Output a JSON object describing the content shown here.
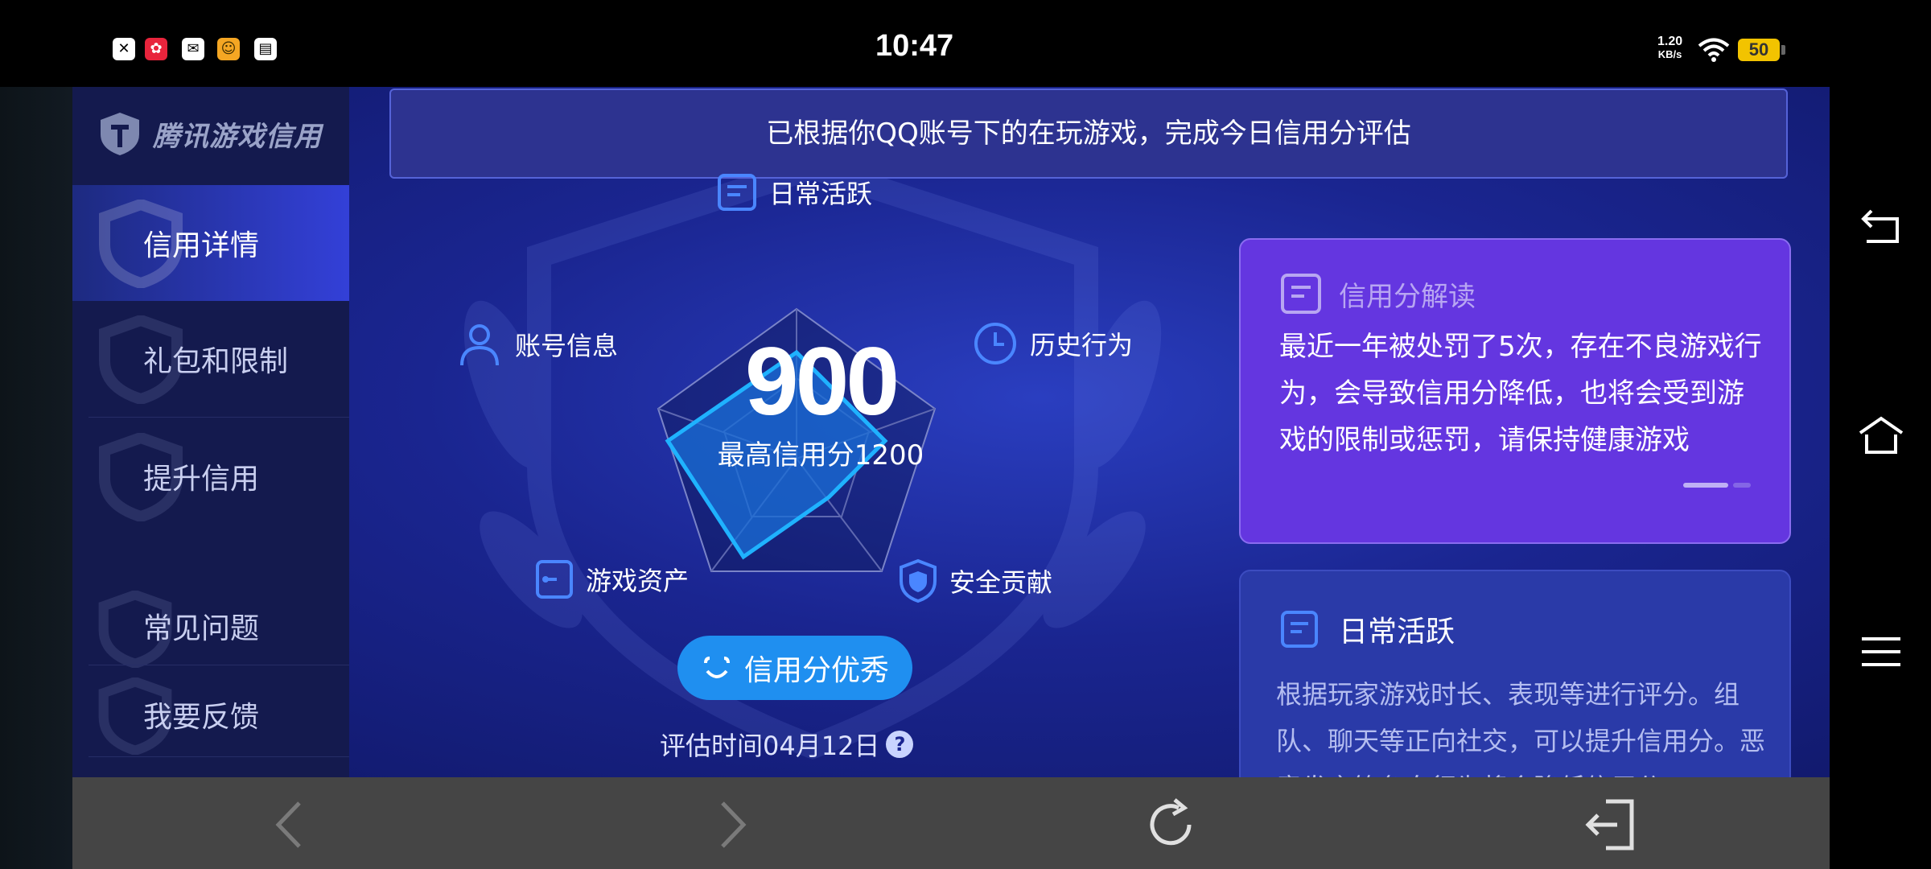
{
  "status_bar": {
    "time": "10:47",
    "net_speed_value": "1.20",
    "net_speed_unit": "KB/s",
    "battery": "50",
    "notification_icons": [
      "x-app-icon",
      "red-app-icon",
      "mail-app-icon",
      "game-app-icon",
      "card-app-icon"
    ]
  },
  "app": {
    "logo_text": "腾讯游戏信用",
    "sidebar": [
      {
        "label": "信用详情",
        "active": true
      },
      {
        "label": "礼包和限制",
        "active": false
      },
      {
        "label": "提升信用",
        "active": false
      },
      {
        "label": "常见问题",
        "active": false
      },
      {
        "label": "我要反馈",
        "active": false
      }
    ],
    "banner": "已根据你QQ账号下的在玩游戏，完成今日信用分评估",
    "radar": {
      "labels": {
        "daily": "日常活跃",
        "account": "账号信息",
        "history": "历史行为",
        "assets": "游戏资产",
        "security": "安全贡献"
      }
    },
    "score": "900",
    "max_score_text": "最高信用分1200",
    "rating_label": "信用分优秀",
    "eval_time": "评估时间04月12日",
    "help_mark": "?",
    "cards": {
      "interpret": {
        "title": "信用分解读",
        "body": "最近一年被处罚了5次，存在不良游戏行为，会导致信用分降低，也将会受到游戏的限制或惩罚，请保持健康游戏"
      },
      "daily": {
        "title": "日常活跃",
        "body": "根据玩家游戏时长、表现等进行评分。组队、聊天等正向社交，可以提升信用分。恶意发言等负向行为将会降低信用分。"
      }
    },
    "colors": {
      "accent_blue": "#1f8ff0",
      "card_purple": "#6436e0",
      "sidebar_bg": "#141a4e"
    }
  },
  "browser_bar": {
    "buttons": [
      "back-icon",
      "forward-icon",
      "refresh-icon",
      "exit-icon"
    ]
  },
  "system_nav": {
    "buttons": [
      "back-icon",
      "home-icon",
      "menu-icon"
    ]
  }
}
